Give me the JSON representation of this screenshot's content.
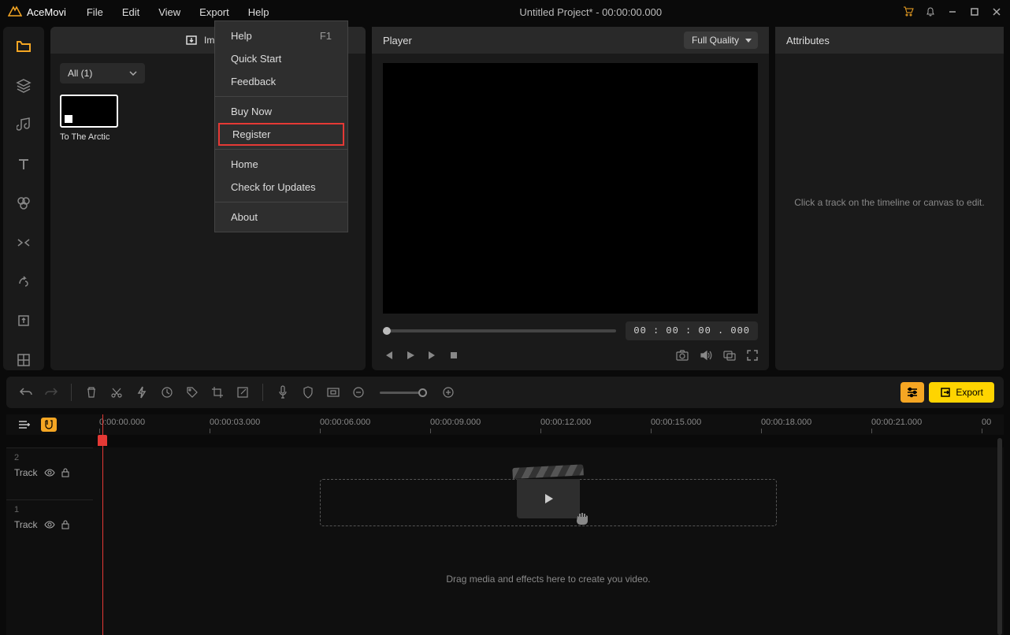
{
  "app": {
    "name": "AceMovi"
  },
  "titlebar": {
    "title": "Untitled Project* - 00:00:00.000"
  },
  "menubar": {
    "file": "File",
    "edit": "Edit",
    "view": "View",
    "export": "Export",
    "help": "Help"
  },
  "helpMenu": {
    "help": "Help",
    "helpShortcut": "F1",
    "quickStart": "Quick Start",
    "feedback": "Feedback",
    "buyNow": "Buy Now",
    "register": "Register",
    "home": "Home",
    "checkUpdates": "Check for Updates",
    "about": "About"
  },
  "media": {
    "importLabel": "Import",
    "filterLabel": "All (1)",
    "clip1": "To The Arctic"
  },
  "player": {
    "title": "Player",
    "quality": "Full Quality",
    "time": "00 : 00 : 00 . 000"
  },
  "attributes": {
    "title": "Attributes",
    "emptyText": "Click a track on the timeline or canvas to edit."
  },
  "toolbar": {
    "exportLabel": "Export"
  },
  "timeline": {
    "ticks": [
      "0:00:00.000",
      "00:00:03.000",
      "00:00:06.000",
      "00:00:09.000",
      "00:00:12.000",
      "00:00:15.000",
      "00:00:18.000",
      "00:00:21.000",
      "00"
    ],
    "track2Num": "2",
    "track1Num": "1",
    "trackLabel": "Track",
    "dropText": "Drag media and effects here to create you video."
  }
}
